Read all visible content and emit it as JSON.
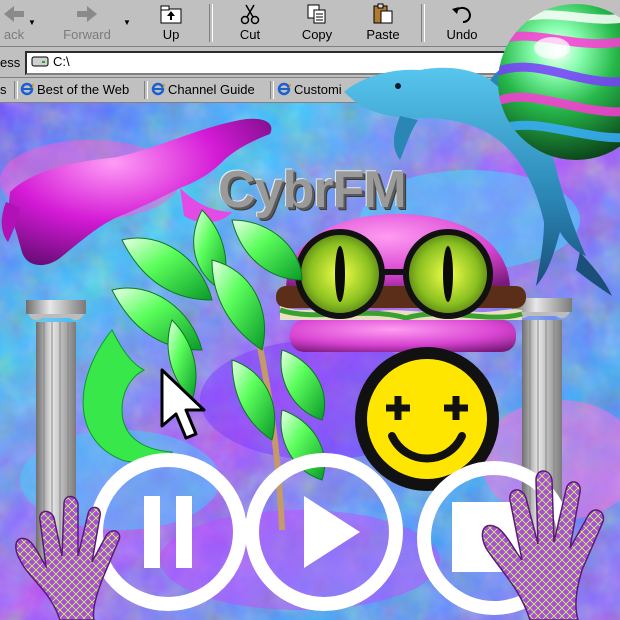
{
  "toolbar": {
    "back_label": "ack",
    "forward_label": "Forward",
    "up_label": "Up",
    "cut_label": "Cut",
    "copy_label": "Copy",
    "paste_label": "Paste",
    "undo_label": "Undo"
  },
  "address": {
    "label": "ess",
    "value": "C:\\"
  },
  "links": {
    "items": [
      "Best of the Web",
      "Channel Guide",
      "Customi"
    ]
  },
  "artwork": {
    "title": "CybrFM"
  },
  "colors": {
    "chrome": "#c0c0c0",
    "smiley": "#ffe600",
    "palm": "#3cff3c",
    "dolphin": "#3aa0c8",
    "figure": "#d41ad6"
  },
  "icons": [
    "back-arrow-icon",
    "forward-arrow-icon",
    "up-folder-icon",
    "scissors-icon",
    "copy-icon",
    "paste-icon",
    "undo-icon",
    "drive-icon",
    "ie-icon",
    "cursor-arrow-icon",
    "pause-icon",
    "play-icon",
    "stop-icon"
  ]
}
